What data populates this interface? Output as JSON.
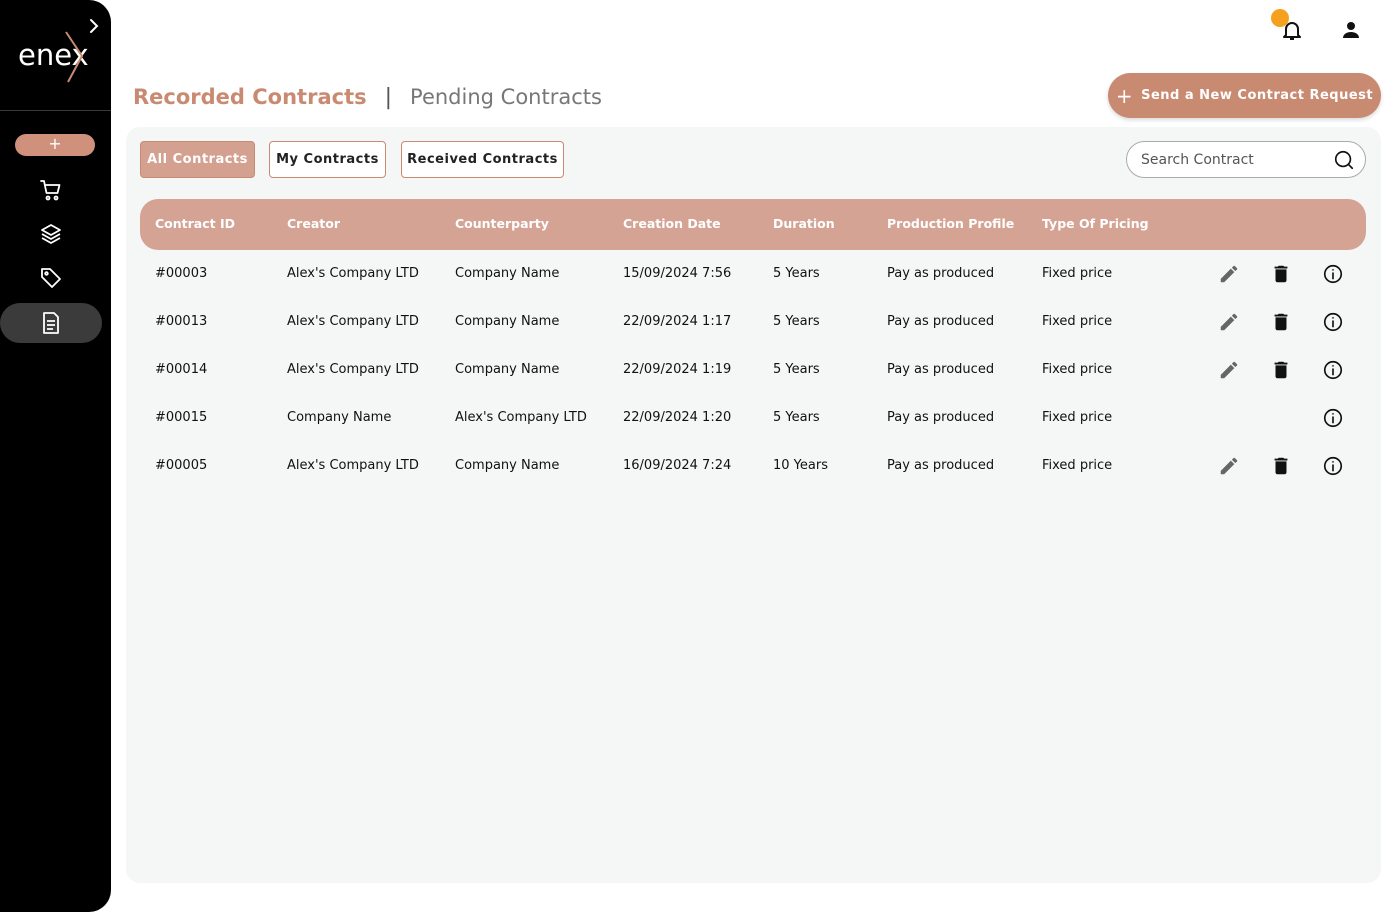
{
  "sidebar": {
    "logo_text": "enex",
    "add_label": "+",
    "nav": [
      {
        "name": "cart-icon"
      },
      {
        "name": "layers-icon"
      },
      {
        "name": "tag-icon"
      },
      {
        "name": "document-icon",
        "active": true
      }
    ]
  },
  "header": {
    "tabs": [
      {
        "label": "Recorded Contracts",
        "active": true
      },
      {
        "label": "Pending Contracts",
        "active": false
      }
    ],
    "separator": "|",
    "send_button": {
      "icon": "+",
      "label": "Send a New Contract Request"
    }
  },
  "filters": [
    {
      "label": "All Contracts",
      "active": true
    },
    {
      "label": "My Contracts",
      "active": false
    },
    {
      "label": "Received Contracts",
      "active": false
    }
  ],
  "search": {
    "placeholder": "Search Contract"
  },
  "table": {
    "columns": [
      "Contract ID",
      "Creator",
      "Counterparty",
      "Creation Date",
      "Duration",
      "Production Profile",
      "Type Of Pricing"
    ],
    "rows": [
      {
        "cells": [
          "#00003",
          "Alex's Company LTD",
          "Company Name",
          "15/09/2024 7:56",
          "5 Years",
          "Pay as produced",
          "Fixed price"
        ],
        "editable": true
      },
      {
        "cells": [
          "#00013",
          "Alex's Company LTD",
          "Company Name",
          "22/09/2024 1:17",
          "5 Years",
          "Pay as produced",
          "Fixed price"
        ],
        "editable": true
      },
      {
        "cells": [
          "#00014",
          "Alex's Company LTD",
          "Company Name",
          "22/09/2024 1:19",
          "5 Years",
          "Pay as produced",
          "Fixed price"
        ],
        "editable": true
      },
      {
        "cells": [
          "#00015",
          "Company Name",
          "Alex's Company LTD",
          "22/09/2024 1:20",
          "5 Years",
          "Pay as produced",
          "Fixed price"
        ],
        "editable": false
      },
      {
        "cells": [
          "#00005",
          "Alex's Company LTD",
          "Company Name",
          "16/09/2024 7:24",
          "10 Years",
          "Pay as produced",
          "Fixed price"
        ],
        "editable": true
      }
    ]
  },
  "colors": {
    "accent": "#c98a72",
    "header_row": "#d4a394",
    "notification_dot": "#f5a01e",
    "sidebar": "#000000"
  }
}
